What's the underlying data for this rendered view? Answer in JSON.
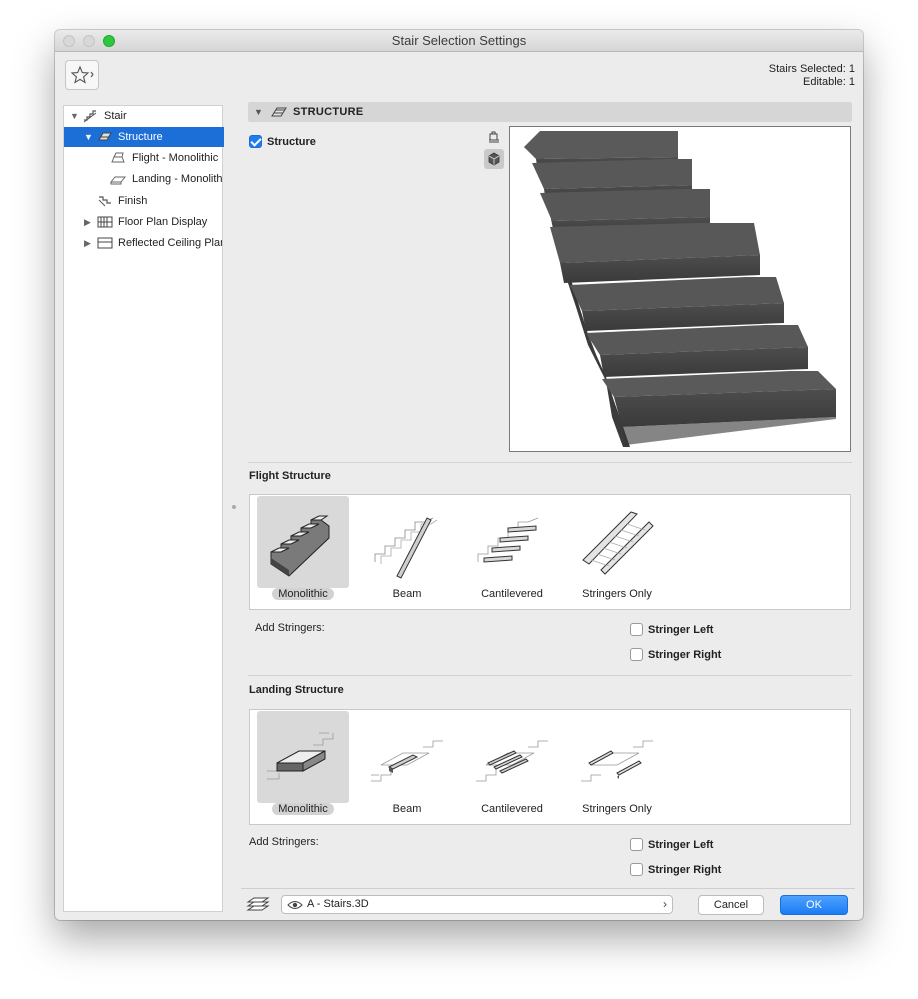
{
  "window": {
    "title": "Stair Selection Settings"
  },
  "selection_info": {
    "selected": "Stairs Selected: 1",
    "editable": "Editable: 1"
  },
  "tree": {
    "items": [
      {
        "label": "Stair",
        "icon": "stair-icon"
      },
      {
        "label": "Structure",
        "icon": "structure-icon",
        "selected": true
      },
      {
        "label": "Flight - Monolithic",
        "icon": "flight-icon"
      },
      {
        "label": "Landing - Monolithic",
        "icon": "landing-icon"
      },
      {
        "label": "Finish",
        "icon": "finish-icon"
      },
      {
        "label": "Floor Plan Display",
        "icon": "floor-plan-icon"
      },
      {
        "label": "Reflected Ceiling Plan",
        "icon": "ceiling-plan-icon"
      }
    ]
  },
  "section": {
    "title": "STRUCTURE",
    "checkbox_label": "Structure",
    "checked": true
  },
  "flight_structure": {
    "title": "Flight Structure",
    "options": [
      "Monolithic",
      "Beam",
      "Cantilevered",
      "Stringers Only"
    ],
    "selected": "Monolithic",
    "add_stringers_label": "Add Stringers:",
    "stringer_left": "Stringer Left",
    "stringer_right": "Stringer Right"
  },
  "landing_structure": {
    "title": "Landing Structure",
    "options": [
      "Monolithic",
      "Beam",
      "Cantilevered",
      "Stringers Only"
    ],
    "selected": "Monolithic",
    "add_stringers_label": "Add Stringers:",
    "stringer_left": "Stringer Left",
    "stringer_right": "Stringer Right"
  },
  "footer": {
    "layer": "A - Stairs.3D",
    "cancel": "Cancel",
    "ok": "OK"
  },
  "colors": {
    "accent": "#1d6fd8",
    "stair": "#4a4a4a"
  }
}
